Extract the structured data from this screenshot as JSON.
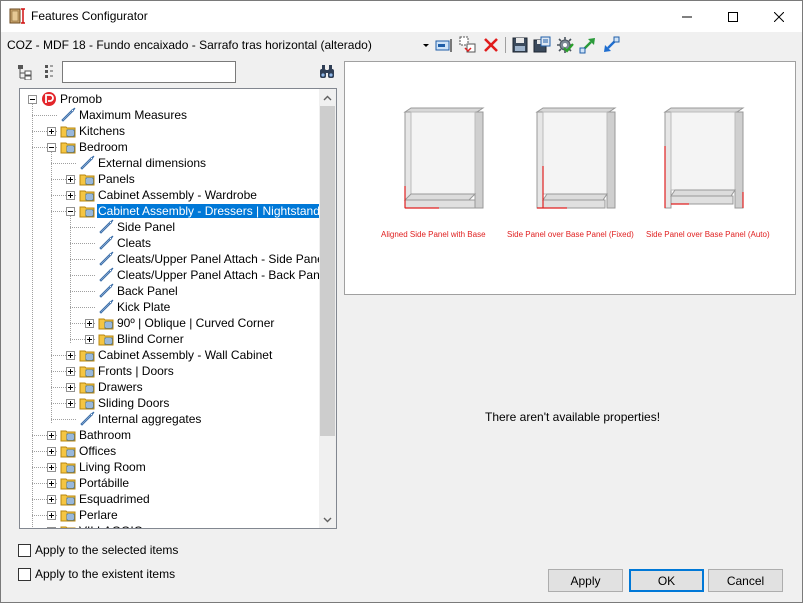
{
  "window": {
    "title": "Features Configurator",
    "icon": "app-cabinet-icon"
  },
  "config": {
    "current": "COZ - MDF 18 - Fundo encaixado - Sarrafo tras horizontal (alterado)",
    "toolbar_icons": [
      "dropdown-arrow-icon",
      "rename-icon",
      "copy-icon",
      "delete-icon",
      "save-icon",
      "save-as-icon",
      "settings-icon",
      "export-icon",
      "import-icon"
    ]
  },
  "search": {
    "value": "",
    "placeholder": ""
  },
  "tree": {
    "nodes": [
      {
        "label": "Promob",
        "level": 0,
        "expander": "minus",
        "icon": "promob-logo-icon"
      },
      {
        "label": "Maximum Measures",
        "level": 1,
        "expander": "none",
        "icon": "tag-icon"
      },
      {
        "label": "Kitchens",
        "level": 1,
        "expander": "plus",
        "icon": "folder-icon"
      },
      {
        "label": "Bedroom",
        "level": 1,
        "expander": "minus",
        "icon": "folder-icon"
      },
      {
        "label": "External dimensions",
        "level": 2,
        "expander": "none",
        "icon": "tag-icon"
      },
      {
        "label": "Panels",
        "level": 2,
        "expander": "plus",
        "icon": "folder-icon"
      },
      {
        "label": "Cabinet Assembly - Wardrobe",
        "level": 2,
        "expander": "plus",
        "icon": "folder-icon"
      },
      {
        "label": "Cabinet Assembly - Dressers | Nightstands",
        "level": 2,
        "expander": "minus",
        "icon": "folder-icon",
        "selected": true
      },
      {
        "label": "Side Panel",
        "level": 3,
        "expander": "none",
        "icon": "tag-icon"
      },
      {
        "label": "Cleats",
        "level": 3,
        "expander": "none",
        "icon": "tag-icon"
      },
      {
        "label": "Cleats/Upper Panel Attach - Side Panel",
        "level": 3,
        "expander": "none",
        "icon": "tag-icon"
      },
      {
        "label": "Cleats/Upper Panel Attach - Back Panel",
        "level": 3,
        "expander": "none",
        "icon": "tag-icon"
      },
      {
        "label": "Back Panel",
        "level": 3,
        "expander": "none",
        "icon": "tag-icon"
      },
      {
        "label": " Kick Plate",
        "level": 3,
        "expander": "none",
        "icon": "tag-icon"
      },
      {
        "label": "90º | Oblique | Curved Corner",
        "level": 3,
        "expander": "plus",
        "icon": "folder-icon"
      },
      {
        "label": "Blind Corner",
        "level": 3,
        "expander": "plus",
        "icon": "folder-icon"
      },
      {
        "label": "Cabinet Assembly - Wall Cabinet",
        "level": 2,
        "expander": "plus",
        "icon": "folder-icon"
      },
      {
        "label": "Fronts | Doors",
        "level": 2,
        "expander": "plus",
        "icon": "folder-icon"
      },
      {
        "label": "Drawers",
        "level": 2,
        "expander": "plus",
        "icon": "folder-icon"
      },
      {
        "label": "Sliding Doors",
        "level": 2,
        "expander": "plus",
        "icon": "folder-icon"
      },
      {
        "label": "Internal aggregates",
        "level": 2,
        "expander": "none",
        "icon": "tag-icon"
      },
      {
        "label": "Bathroom",
        "level": 1,
        "expander": "plus",
        "icon": "folder-icon"
      },
      {
        "label": "Offices",
        "level": 1,
        "expander": "plus",
        "icon": "folder-icon"
      },
      {
        "label": "Living Room",
        "level": 1,
        "expander": "plus",
        "icon": "folder-icon"
      },
      {
        "label": "Portábille",
        "level": 1,
        "expander": "plus",
        "icon": "folder-icon"
      },
      {
        "label": "Esquadrimed",
        "level": 1,
        "expander": "plus",
        "icon": "folder-icon"
      },
      {
        "label": "Perlare",
        "level": 1,
        "expander": "plus",
        "icon": "folder-icon"
      },
      {
        "label": "VILLAGGIO",
        "level": 1,
        "expander": "plus",
        "icon": "folder-icon"
      }
    ]
  },
  "options": {
    "apply_selected": "Apply to the selected items",
    "apply_existent": "Apply to the existent items"
  },
  "preview": {
    "captions": [
      "Aligned Side Panel with Base",
      "Side Panel over Base Panel (Fixed)",
      "Side Panel over Base Panel (Auto)"
    ],
    "highlight_color": "#e02020"
  },
  "properties": {
    "empty_message": "There aren't available properties!"
  },
  "buttons": {
    "apply": "Apply",
    "ok": "OK",
    "cancel": "Cancel"
  },
  "colors": {
    "selection": "#0078d7",
    "folder": "#f5c542",
    "delete": "#e01b1b"
  }
}
